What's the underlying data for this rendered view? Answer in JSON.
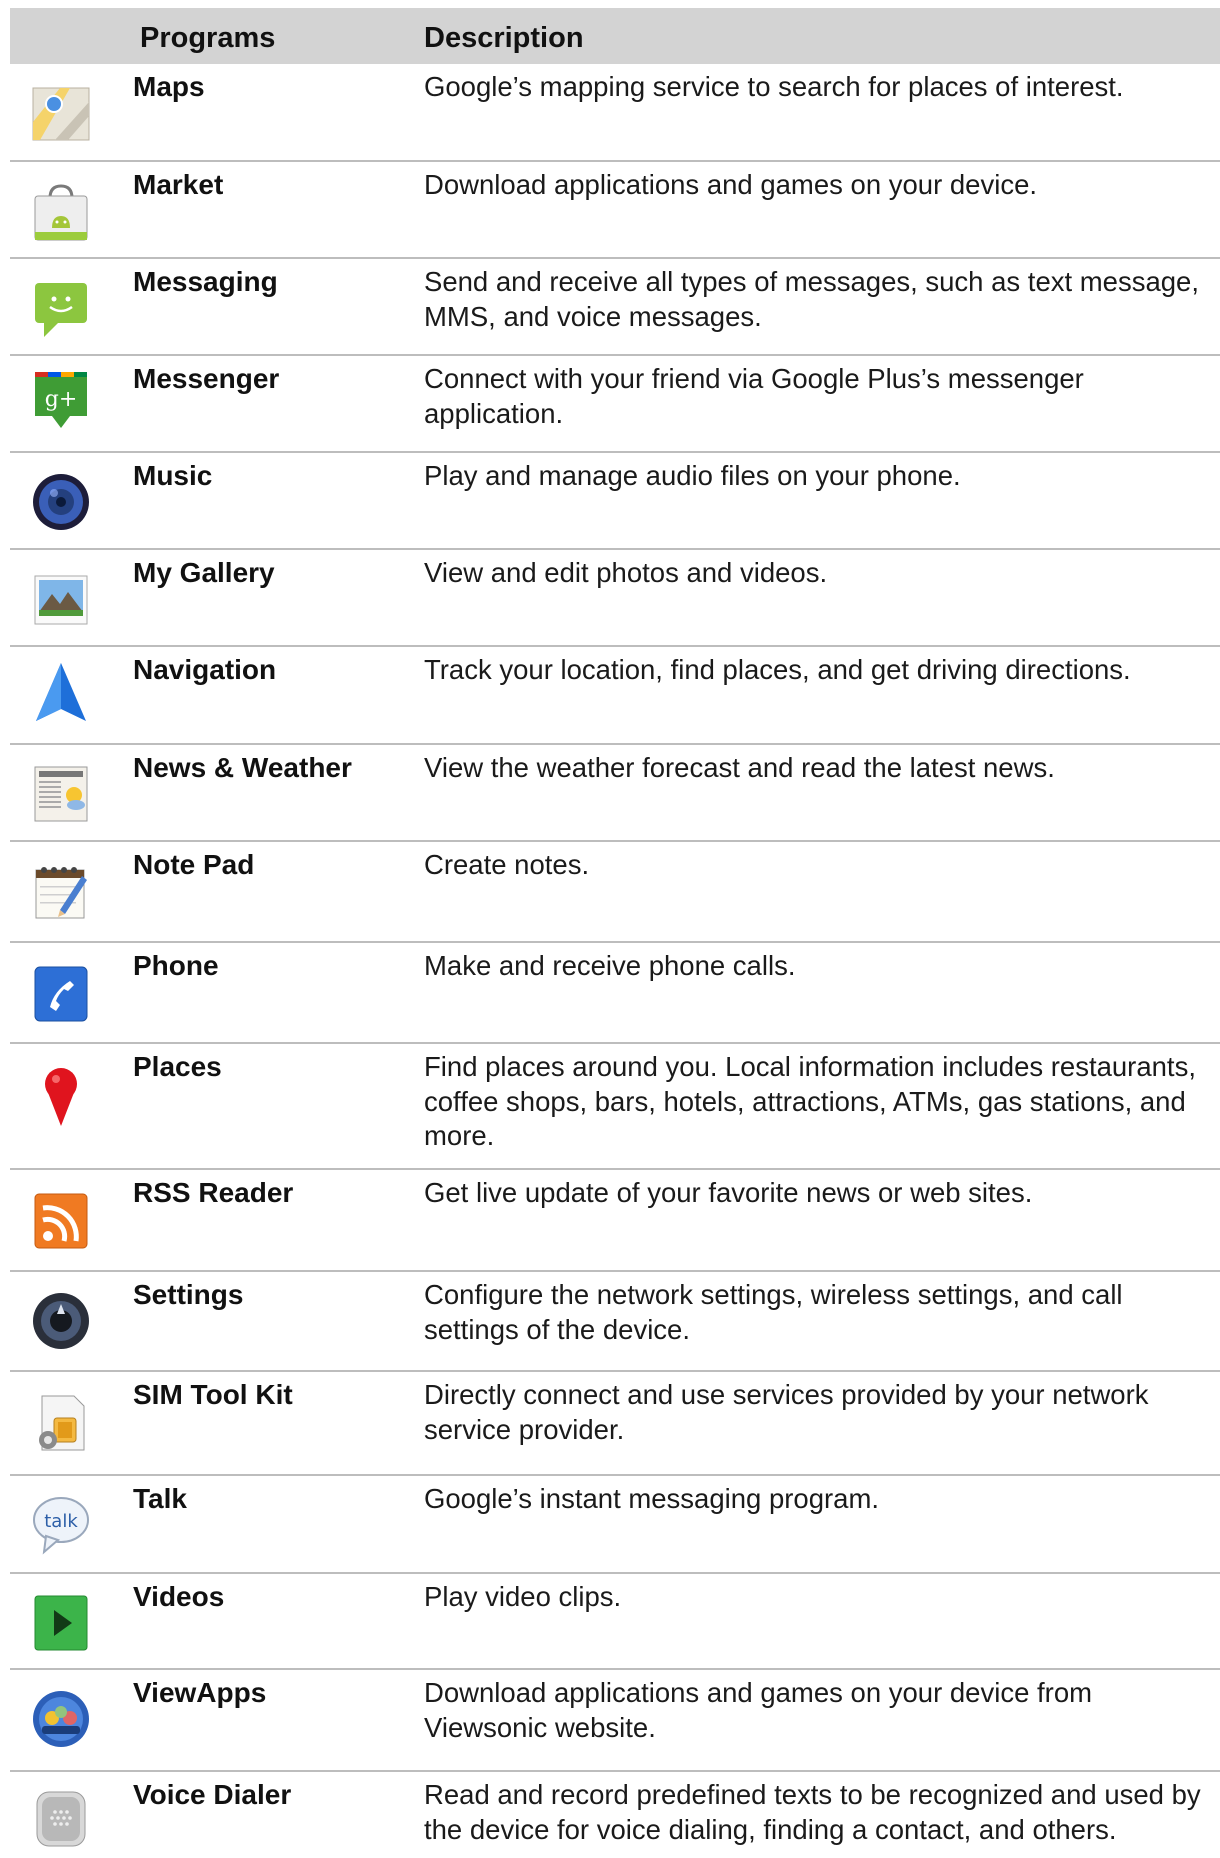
{
  "header": {
    "programs": "Programs",
    "description": "Description"
  },
  "rows": [
    {
      "name": "Maps",
      "desc": "Google’s mapping service to search for places of interest.",
      "icon": "maps-icon"
    },
    {
      "name": "Market",
      "desc": "Download applications and games on your device.",
      "icon": "market-icon"
    },
    {
      "name": "Messaging",
      "desc": "Send and receive all types of messages, such as text message, MMS, and voice messages.",
      "icon": "messaging-icon"
    },
    {
      "name": "Messenger",
      "desc": "Connect with your friend via Google Plus’s messenger application.",
      "icon": "messenger-icon"
    },
    {
      "name": "Music",
      "desc": "Play and manage audio files on your phone.",
      "icon": "music-icon"
    },
    {
      "name": "My Gallery",
      "desc": "View and edit photos and videos.",
      "icon": "gallery-icon"
    },
    {
      "name": "Navigation",
      "desc": "Track your location, find places, and get driving directions.",
      "icon": "navigation-icon"
    },
    {
      "name": "News & Weather",
      "desc": "View the weather forecast and read the latest news.",
      "icon": "news-weather-icon"
    },
    {
      "name": "Note Pad",
      "desc": "Create notes.",
      "icon": "notepad-icon"
    },
    {
      "name": "Phone",
      "desc": "Make and receive phone calls.",
      "icon": "phone-icon"
    },
    {
      "name": "Places",
      "desc": "Find places around you. Local information includes restaurants, coffee shops, bars, hotels, attractions, ATMs, gas stations, and more.",
      "icon": "places-icon"
    },
    {
      "name": "RSS Reader",
      "desc": "Get live update of your favorite news or web sites.",
      "icon": "rss-icon"
    },
    {
      "name": "Settings",
      "desc": "Configure the network settings, wireless settings, and call settings of the device.",
      "icon": "settings-icon"
    },
    {
      "name": "SIM Tool Kit",
      "desc": "Directly connect and use services provided by your network service provider.",
      "icon": "sim-toolkit-icon"
    },
    {
      "name": "Talk",
      "desc": "Google’s instant messaging program.",
      "icon": "talk-icon",
      "icon_text": "talk"
    },
    {
      "name": "Videos",
      "desc": "Play video clips.",
      "icon": "videos-icon"
    },
    {
      "name": "ViewApps",
      "desc": "Download applications and games on your device from Viewsonic website.",
      "icon": "viewapps-icon"
    },
    {
      "name": "Voice Dialer",
      "desc": "Read and record predefined texts to be recognized and used by the device for voice dialing, finding a contact, and others.",
      "icon": "voice-dialer-icon"
    }
  ],
  "colors": {
    "header_bg": "#d3d3d3",
    "divider": "#bdbdbd"
  }
}
